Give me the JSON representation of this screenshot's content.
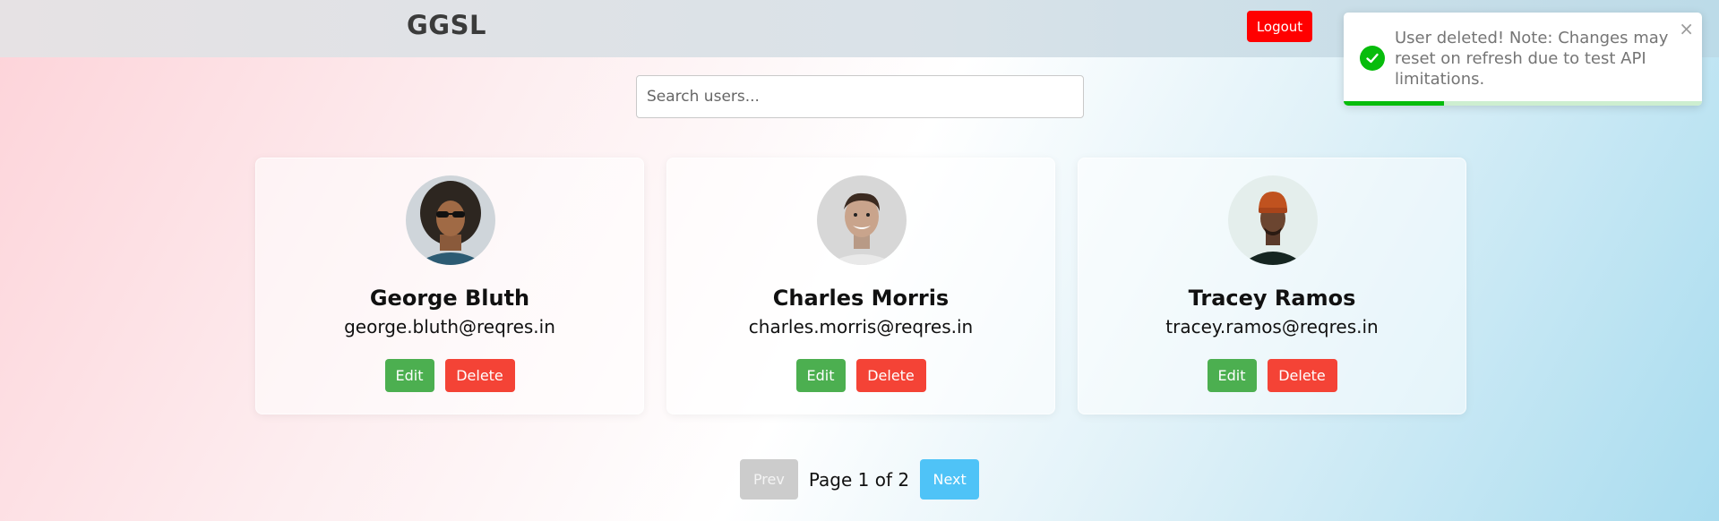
{
  "header": {
    "brand": "GGSL",
    "logout_label": "Logout"
  },
  "search": {
    "placeholder": "Search users...",
    "value": ""
  },
  "users": [
    {
      "name": "George Bluth",
      "email": "george.bluth@reqres.in",
      "edit_label": "Edit",
      "delete_label": "Delete",
      "avatar_icon": "avatar-george-bluth"
    },
    {
      "name": "Charles Morris",
      "email": "charles.morris@reqres.in",
      "edit_label": "Edit",
      "delete_label": "Delete",
      "avatar_icon": "avatar-charles-morris"
    },
    {
      "name": "Tracey Ramos",
      "email": "tracey.ramos@reqres.in",
      "edit_label": "Edit",
      "delete_label": "Delete",
      "avatar_icon": "avatar-tracey-ramos"
    }
  ],
  "pagination": {
    "prev_label": "Prev",
    "next_label": "Next",
    "page_info": "Page 1 of 2"
  },
  "toast": {
    "message": "User deleted! Note: Changes may reset on refresh due to test API limitations.",
    "close_glyph": "×",
    "icon": "check-circle-icon",
    "progress_fraction": 0.28
  },
  "colors": {
    "logout": "#ff0000",
    "edit": "#4caf50",
    "delete": "#f44336",
    "next": "#4fc3f7",
    "prev_disabled": "#cccccc",
    "toast_success": "#07bc0c"
  }
}
